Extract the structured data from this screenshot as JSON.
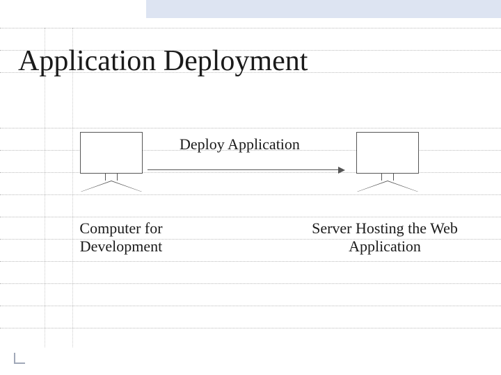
{
  "title": "Application Deployment",
  "arrow_label": "Deploy Application",
  "left_label": "Computer for Development",
  "right_label": "Server Hosting the Web Application"
}
